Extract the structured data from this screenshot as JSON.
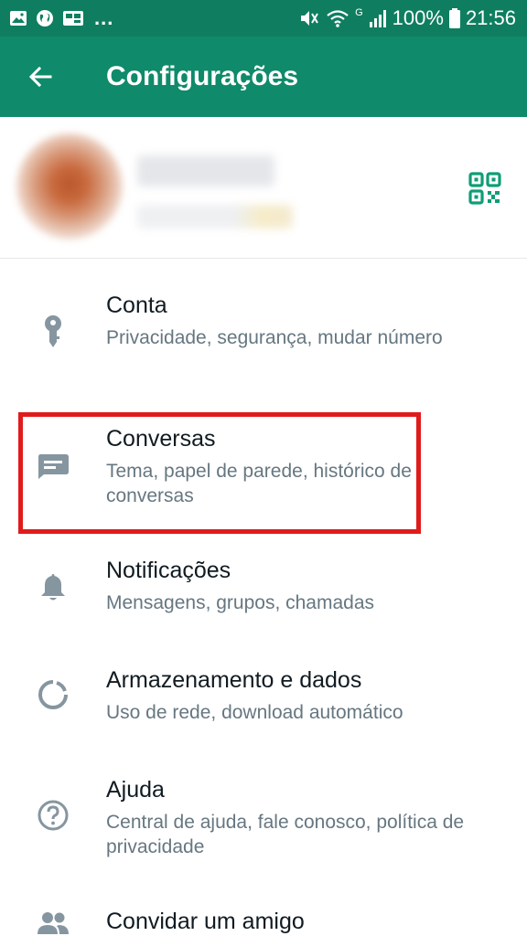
{
  "status_bar": {
    "left_icons": [
      "image-icon",
      "globe-icon",
      "cast-icon"
    ],
    "overflow_dots": "...",
    "right_icons": [
      "mute-icon",
      "wifi-icon",
      "signal-icon"
    ],
    "network_type": "G",
    "battery_percent": "100%",
    "time": "21:56"
  },
  "app_bar": {
    "title": "Configurações",
    "back_icon": "arrow-left-icon",
    "color": "#0f8a6a"
  },
  "profile": {
    "qr_icon": "qr-code-icon"
  },
  "settings": {
    "items": [
      {
        "icon": "key-icon",
        "title": "Conta",
        "subtitle": "Privacidade, segurança, mudar número"
      },
      {
        "icon": "chat-icon",
        "title": "Conversas",
        "subtitle": "Tema, papel de parede, histórico de conversas"
      },
      {
        "icon": "bell-icon",
        "title": "Notificações",
        "subtitle": "Mensagens, grupos, chamadas"
      },
      {
        "icon": "storage-icon",
        "title": "Armazenamento e dados",
        "subtitle": "Uso de rede, download automático"
      },
      {
        "icon": "help-icon",
        "title": "Ajuda",
        "subtitle": "Central de ajuda, fale conosco, política de privacidade"
      },
      {
        "icon": "people-icon",
        "title": "Convidar um amigo",
        "subtitle": ""
      }
    ]
  },
  "colors": {
    "accent": "#0f8a6a",
    "status_bar": "#0f7e60",
    "highlight": "#e01b1b",
    "icon": "#8696a0"
  }
}
